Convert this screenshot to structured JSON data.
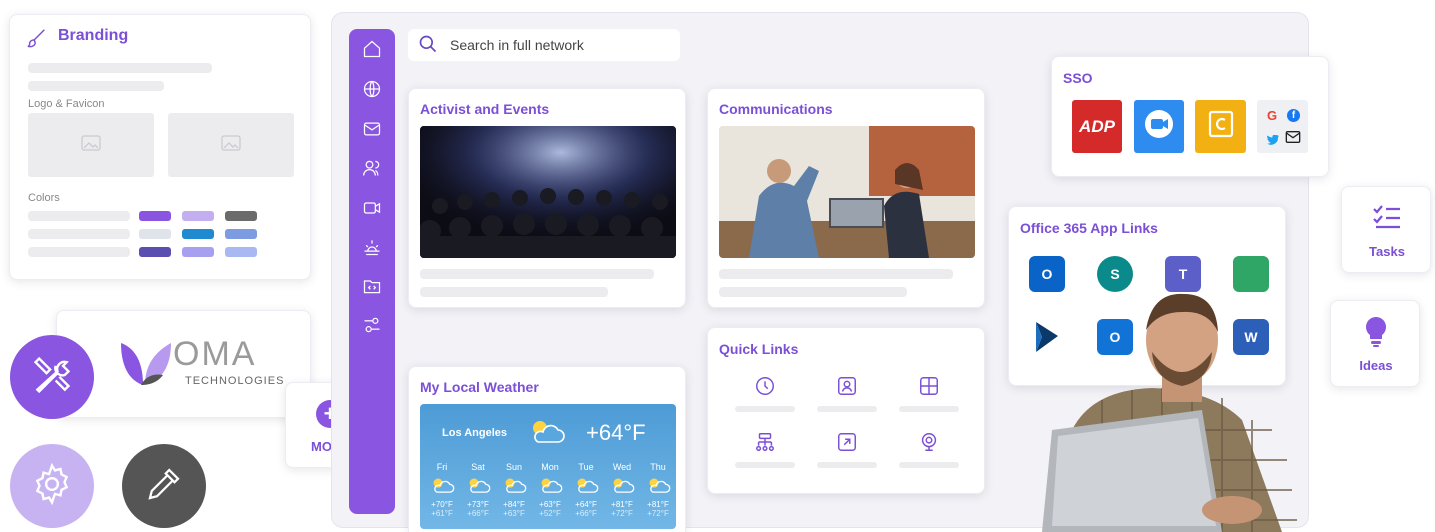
{
  "branding": {
    "title": "Branding",
    "logo_label": "Logo & Favicon",
    "colors_label": "Colors",
    "swatches": [
      "#8a55e0",
      "#c3aef0",
      "#6b6b6b",
      "#dfe3ea",
      "#1f8ad0",
      "#7c9be0",
      "#5a4fb0",
      "#a7a0f0",
      "#a8b8f2"
    ]
  },
  "company": {
    "name_big": "OMA",
    "name_small": "TECHNOLOGIES"
  },
  "more": {
    "label": "MORE",
    "plus": "+"
  },
  "search": {
    "placeholder": "Search in full network"
  },
  "cards": {
    "activist": "Activist and Events",
    "communications": "Communications",
    "quick_links": "Quick Links",
    "weather": "My Local Weather",
    "sso": "SSO",
    "office": "Office 365 App Links"
  },
  "weather": {
    "city": "Los Angeles",
    "temp": "+64°F",
    "days": [
      {
        "day": "Fri",
        "hi": "+70°F",
        "lo": "+61°F"
      },
      {
        "day": "Sat",
        "hi": "+73°F",
        "lo": "+66°F"
      },
      {
        "day": "Sun",
        "hi": "+84°F",
        "lo": "+63°F"
      },
      {
        "day": "Mon",
        "hi": "+63°F",
        "lo": "+52°F"
      },
      {
        "day": "Tue",
        "hi": "+64°F",
        "lo": "+66°F"
      },
      {
        "day": "Wed",
        "hi": "+81°F",
        "lo": "+72°F"
      },
      {
        "day": "Thu",
        "hi": "+81°F",
        "lo": "+72°F"
      }
    ]
  },
  "sso": {
    "adp": "ADP",
    "small_g": "G",
    "small_f": "f"
  },
  "office_icons": {
    "outlook": "O",
    "sharepoint": "S",
    "teams": "T",
    "dynamics": "D",
    "outlook2": "O",
    "word": "W"
  },
  "tasks": {
    "label": "Tasks"
  },
  "ideas": {
    "label": "Ideas"
  },
  "colors": {
    "accent": "#7b4fd6",
    "rail": "#8a55e0"
  }
}
